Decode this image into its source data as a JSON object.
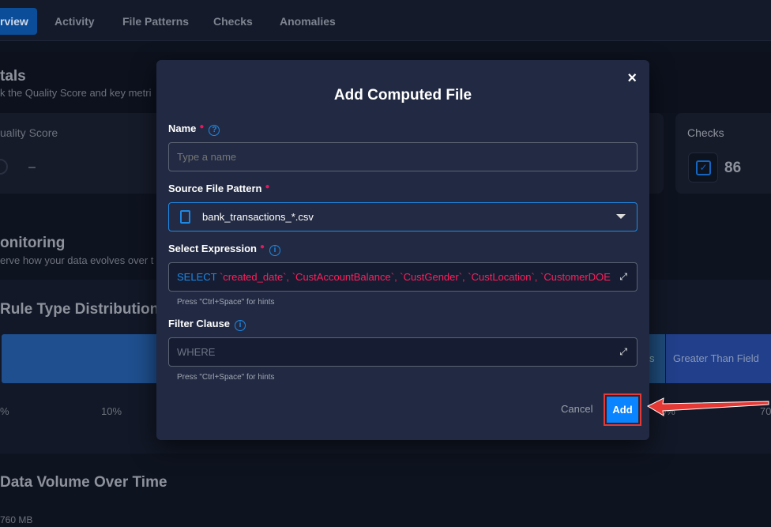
{
  "tabs": [
    "rview",
    "Activity",
    "File Patterns",
    "Checks",
    "Anomalies"
  ],
  "background": {
    "totals_title": "tals",
    "totals_sub": "k the Quality Score and key metri",
    "quality_score_label": "uality Score",
    "quality_score_value": "–",
    "checks_label": "Checks",
    "checks_value": "86",
    "monitoring_title": "onitoring",
    "monitoring_sub": "erve how your data evolves over t",
    "rule_dist_title": "Rule Type Distribution",
    "rule_segments": [
      "s",
      "Greater Than Field"
    ],
    "axis_ticks": [
      "%",
      "10%",
      "0%",
      "70"
    ],
    "volume_title": "Data Volume Over Time",
    "volume_tick": "760 MB"
  },
  "modal": {
    "title": "Add Computed File",
    "close": "×",
    "name_label": "Name",
    "name_placeholder": "Type a name",
    "source_label": "Source File Pattern",
    "source_value": "bank_transactions_*.csv",
    "select_label": "Select Expression",
    "select_keyword": "SELECT",
    "select_columns": " `created_date`, `CustAccountBalance`, `CustGender`, `CustLocation`, `CustomerDOE",
    "hint": "Press \"Ctrl+Space\" for hints",
    "filter_label": "Filter Clause",
    "filter_placeholder": "WHERE",
    "cancel": "Cancel",
    "add": "Add"
  },
  "colors": {
    "accent": "#0a84ff",
    "required": "#e8175d",
    "annotation": "#e53935"
  }
}
